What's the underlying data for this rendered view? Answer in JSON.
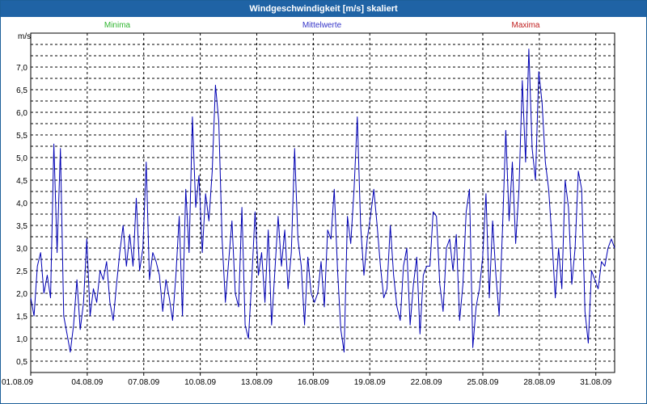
{
  "window": {
    "title": "Windgeschwindigkeit [m/s] skaliert"
  },
  "legend": {
    "min_label": "Minima",
    "mean_label": "Mittelwerte",
    "max_label": "Maxima"
  },
  "colors": {
    "min": "#2fb52f",
    "mean": "#3434c8",
    "max": "#c02020",
    "line": "#0000b4",
    "titlebar": "#1f63a5"
  },
  "chart_data": {
    "type": "line",
    "title": "Windgeschwindigkeit [m/s] skaliert",
    "ylabel": "m/s",
    "xlabel": "",
    "ylim": [
      0.25,
      7.75
    ],
    "yticks": [
      "7,0",
      "6,5",
      "6,0",
      "5,5",
      "5,0",
      "4,5",
      "4,0",
      "3,5",
      "3,0",
      "2,5",
      "2,0",
      "1,5",
      "1,0",
      "0,5"
    ],
    "ytick_values": [
      7.0,
      6.5,
      6.0,
      5.5,
      5.0,
      4.5,
      4.0,
      3.5,
      3.0,
      2.5,
      2.0,
      1.5,
      1.0,
      0.5
    ],
    "x_range_days": [
      1,
      32
    ],
    "xticks": [
      "01.08.09",
      "04.08.09",
      "07.08.09",
      "10.08.09",
      "13.08.09",
      "16.08.09",
      "19.08.09",
      "22.08.09",
      "25.08.09",
      "28.08.09",
      "31.08.09"
    ],
    "xtick_days": [
      1,
      4,
      7,
      10,
      13,
      16,
      19,
      22,
      25,
      28,
      31
    ],
    "grid": true,
    "legend_position": "top",
    "series": [
      {
        "name": "Mittelwerte",
        "x_day": [
          1.0,
          1.25,
          1.5,
          1.75,
          2.0,
          2.25,
          2.5,
          2.75,
          3.0,
          3.25,
          3.5,
          3.75,
          4.0,
          4.25,
          4.5,
          4.75,
          5.0,
          5.25,
          5.5,
          5.75,
          6.0,
          6.25,
          6.5,
          6.75,
          7.0,
          7.25,
          7.5,
          7.75,
          8.0,
          8.25,
          8.5,
          8.75,
          9.0,
          9.25,
          9.5,
          9.75,
          10.0,
          10.25,
          10.5,
          10.75,
          11.0,
          11.25,
          11.5,
          11.75,
          12.0,
          12.25,
          12.5,
          12.75,
          13.0,
          13.25,
          13.5,
          13.75,
          14.0,
          14.25,
          14.5,
          14.75,
          15.0,
          15.25,
          15.5,
          15.75,
          16.0,
          16.25,
          16.5,
          16.75,
          17.0,
          17.25,
          17.5,
          17.75,
          18.0,
          18.25,
          18.5,
          18.75,
          19.0,
          19.25,
          19.5,
          19.75,
          20.0,
          20.25,
          20.5,
          20.75,
          21.0,
          21.25,
          21.5,
          21.75,
          22.0,
          22.25,
          22.5,
          22.75,
          23.0,
          23.25,
          23.5,
          23.75,
          24.0,
          24.25,
          24.5,
          24.75,
          25.0,
          25.25,
          25.5,
          25.75,
          26.0,
          26.25,
          26.5,
          26.75,
          27.0,
          27.25,
          27.5,
          27.75,
          28.0,
          28.25,
          28.5,
          28.75,
          29.0,
          29.25,
          29.5,
          29.75,
          30.0,
          30.25,
          30.5,
          30.75,
          31.0,
          31.25,
          31.5,
          31.75,
          32.0
        ],
        "values": [
          1.9,
          1.5,
          2.6,
          2.9,
          2.0,
          2.4,
          1.9,
          5.3,
          2.9,
          5.2,
          1.5,
          1.1,
          0.7,
          1.3,
          2.3,
          1.2,
          1.8,
          3.2,
          1.5,
          2.1,
          1.8,
          2.5,
          2.3,
          2.7,
          1.8,
          1.4,
          2.2,
          2.9,
          3.5,
          2.6,
          3.3,
          2.6,
          4.1,
          2.5,
          3.0,
          4.9,
          2.3,
          2.9,
          2.7,
          2.4,
          1.6,
          2.3,
          1.9,
          1.4,
          2.4,
          3.7,
          1.5,
          4.3,
          2.9,
          5.9,
          3.9,
          4.6,
          2.9,
          4.2,
          3.6,
          4.7,
          6.6,
          5.8,
          3.2,
          1.8,
          2.7,
          3.6,
          2.0,
          1.7,
          3.9,
          1.3,
          1.0,
          2.3,
          3.8,
          2.4,
          2.9,
          1.8,
          3.4,
          1.3,
          2.5,
          3.7,
          2.6,
          3.4,
          2.1,
          2.9,
          5.2,
          3.2,
          2.6,
          1.3,
          2.8,
          2.0,
          1.8,
          2.0,
          2.7,
          1.7,
          3.4,
          3.2,
          4.3,
          2.5,
          1.2,
          0.7,
          3.7,
          3.1,
          4.3,
          5.9,
          3.5,
          2.4,
          3.2,
          3.7,
          4.3,
          3.5,
          2.6,
          1.9,
          2.1,
          3.5,
          2.4,
          1.7,
          1.4,
          2.6,
          3.0,
          1.3,
          2.2,
          2.8,
          1.1,
          2.4,
          2.6,
          2.6,
          3.8,
          3.7,
          2.2,
          1.6,
          3.0,
          3.2,
          2.5,
          3.3,
          1.4,
          2.2,
          3.8,
          4.3,
          0.8,
          1.7,
          2.1,
          2.8,
          4.2,
          1.9,
          3.6,
          2.4,
          1.5,
          3.4,
          5.6,
          3.6,
          4.9,
          3.1,
          4.3,
          6.7,
          4.9,
          7.4,
          5.2,
          4.5,
          6.9,
          6.2,
          4.9,
          4.3,
          3.2,
          1.9,
          3.0,
          2.1,
          4.5,
          3.9,
          2.2,
          3.0,
          4.7,
          4.3,
          1.6,
          0.9,
          2.5,
          2.3,
          2.1,
          2.7,
          2.6,
          3.0,
          3.2,
          3.0
        ]
      }
    ]
  }
}
